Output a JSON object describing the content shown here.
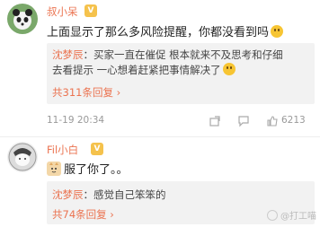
{
  "comment1": {
    "username": "叔小呆",
    "text": "上面显示了那么多风险提醒，你都没看到吗",
    "reply": {
      "user": "沈梦辰",
      "line1": "：买家一直在催促 根本就来不及思考和仔细",
      "line2": "去看提示 一心想着赶紧把事情解决了",
      "count": "共311条回复",
      "count_arrow": "›"
    },
    "time": "11-19 20:34",
    "likes": "6213"
  },
  "comment2": {
    "username": "Fil小白",
    "text": "服了你了。。",
    "reply": {
      "user": "沈梦辰",
      "line1": "：感觉自己笨笨的",
      "count": "共74条回复",
      "count_arrow": "›"
    }
  },
  "watermark": {
    "text": "@打工喵"
  },
  "colors": {
    "accent": "#eb7350",
    "reply_bg": "#f2f2f2",
    "meta": "#999999"
  }
}
